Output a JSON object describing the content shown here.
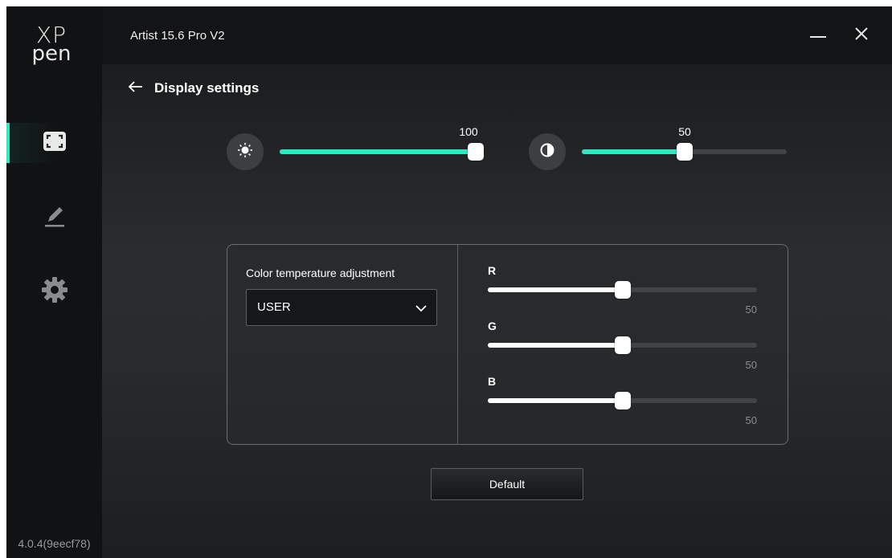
{
  "sidebar": {
    "logo_top": "XP",
    "logo_bottom": "pen",
    "items": [
      {
        "name": "display",
        "active": true
      },
      {
        "name": "pen",
        "active": false
      },
      {
        "name": "settings",
        "active": false
      }
    ],
    "version": "4.0.4(9eecf78)"
  },
  "header": {
    "title": "Artist 15.6 Pro V2"
  },
  "page": {
    "back_label": "Display settings"
  },
  "brightness": {
    "value": "100",
    "level": 1.0,
    "color": "#2ee8c2"
  },
  "contrast": {
    "value": "50",
    "level": 0.5,
    "color": "#2ee8c2"
  },
  "color_temperature": {
    "label": "Color temperature adjustment",
    "selected": "USER"
  },
  "rgb": [
    {
      "label": "R",
      "value": "50",
      "level": 0.5
    },
    {
      "label": "G",
      "value": "50",
      "level": 0.5
    },
    {
      "label": "B",
      "value": "50",
      "level": 0.5
    }
  ],
  "default_button": "Default",
  "colors": {
    "accent": "#2ee8c2",
    "background": "#1c1d1f"
  }
}
